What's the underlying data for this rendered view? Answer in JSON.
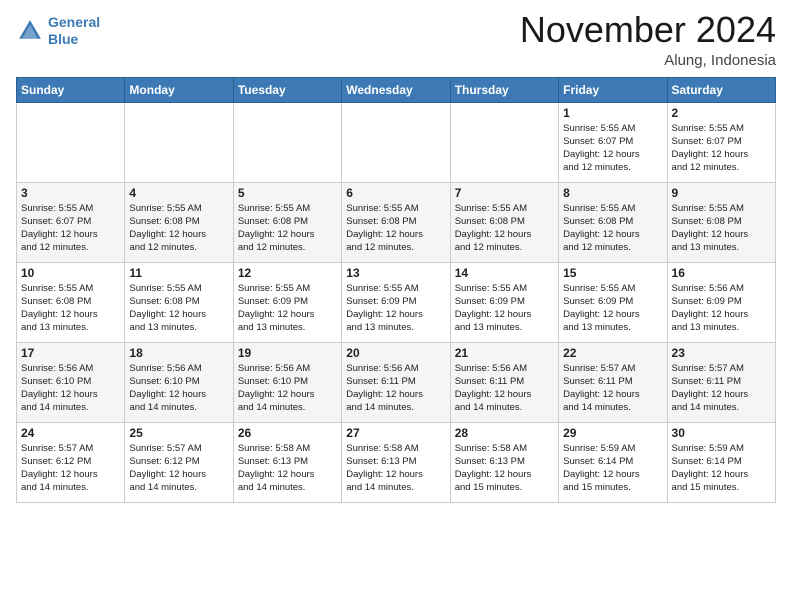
{
  "header": {
    "logo_line1": "General",
    "logo_line2": "Blue",
    "title": "November 2024",
    "subtitle": "Alung, Indonesia"
  },
  "days_of_week": [
    "Sunday",
    "Monday",
    "Tuesday",
    "Wednesday",
    "Thursday",
    "Friday",
    "Saturday"
  ],
  "weeks": [
    [
      {
        "day": "",
        "info": ""
      },
      {
        "day": "",
        "info": ""
      },
      {
        "day": "",
        "info": ""
      },
      {
        "day": "",
        "info": ""
      },
      {
        "day": "",
        "info": ""
      },
      {
        "day": "1",
        "info": "Sunrise: 5:55 AM\nSunset: 6:07 PM\nDaylight: 12 hours\nand 12 minutes."
      },
      {
        "day": "2",
        "info": "Sunrise: 5:55 AM\nSunset: 6:07 PM\nDaylight: 12 hours\nand 12 minutes."
      }
    ],
    [
      {
        "day": "3",
        "info": "Sunrise: 5:55 AM\nSunset: 6:07 PM\nDaylight: 12 hours\nand 12 minutes."
      },
      {
        "day": "4",
        "info": "Sunrise: 5:55 AM\nSunset: 6:08 PM\nDaylight: 12 hours\nand 12 minutes."
      },
      {
        "day": "5",
        "info": "Sunrise: 5:55 AM\nSunset: 6:08 PM\nDaylight: 12 hours\nand 12 minutes."
      },
      {
        "day": "6",
        "info": "Sunrise: 5:55 AM\nSunset: 6:08 PM\nDaylight: 12 hours\nand 12 minutes."
      },
      {
        "day": "7",
        "info": "Sunrise: 5:55 AM\nSunset: 6:08 PM\nDaylight: 12 hours\nand 12 minutes."
      },
      {
        "day": "8",
        "info": "Sunrise: 5:55 AM\nSunset: 6:08 PM\nDaylight: 12 hours\nand 12 minutes."
      },
      {
        "day": "9",
        "info": "Sunrise: 5:55 AM\nSunset: 6:08 PM\nDaylight: 12 hours\nand 13 minutes."
      }
    ],
    [
      {
        "day": "10",
        "info": "Sunrise: 5:55 AM\nSunset: 6:08 PM\nDaylight: 12 hours\nand 13 minutes."
      },
      {
        "day": "11",
        "info": "Sunrise: 5:55 AM\nSunset: 6:08 PM\nDaylight: 12 hours\nand 13 minutes."
      },
      {
        "day": "12",
        "info": "Sunrise: 5:55 AM\nSunset: 6:09 PM\nDaylight: 12 hours\nand 13 minutes."
      },
      {
        "day": "13",
        "info": "Sunrise: 5:55 AM\nSunset: 6:09 PM\nDaylight: 12 hours\nand 13 minutes."
      },
      {
        "day": "14",
        "info": "Sunrise: 5:55 AM\nSunset: 6:09 PM\nDaylight: 12 hours\nand 13 minutes."
      },
      {
        "day": "15",
        "info": "Sunrise: 5:55 AM\nSunset: 6:09 PM\nDaylight: 12 hours\nand 13 minutes."
      },
      {
        "day": "16",
        "info": "Sunrise: 5:56 AM\nSunset: 6:09 PM\nDaylight: 12 hours\nand 13 minutes."
      }
    ],
    [
      {
        "day": "17",
        "info": "Sunrise: 5:56 AM\nSunset: 6:10 PM\nDaylight: 12 hours\nand 14 minutes."
      },
      {
        "day": "18",
        "info": "Sunrise: 5:56 AM\nSunset: 6:10 PM\nDaylight: 12 hours\nand 14 minutes."
      },
      {
        "day": "19",
        "info": "Sunrise: 5:56 AM\nSunset: 6:10 PM\nDaylight: 12 hours\nand 14 minutes."
      },
      {
        "day": "20",
        "info": "Sunrise: 5:56 AM\nSunset: 6:11 PM\nDaylight: 12 hours\nand 14 minutes."
      },
      {
        "day": "21",
        "info": "Sunrise: 5:56 AM\nSunset: 6:11 PM\nDaylight: 12 hours\nand 14 minutes."
      },
      {
        "day": "22",
        "info": "Sunrise: 5:57 AM\nSunset: 6:11 PM\nDaylight: 12 hours\nand 14 minutes."
      },
      {
        "day": "23",
        "info": "Sunrise: 5:57 AM\nSunset: 6:11 PM\nDaylight: 12 hours\nand 14 minutes."
      }
    ],
    [
      {
        "day": "24",
        "info": "Sunrise: 5:57 AM\nSunset: 6:12 PM\nDaylight: 12 hours\nand 14 minutes."
      },
      {
        "day": "25",
        "info": "Sunrise: 5:57 AM\nSunset: 6:12 PM\nDaylight: 12 hours\nand 14 minutes."
      },
      {
        "day": "26",
        "info": "Sunrise: 5:58 AM\nSunset: 6:13 PM\nDaylight: 12 hours\nand 14 minutes."
      },
      {
        "day": "27",
        "info": "Sunrise: 5:58 AM\nSunset: 6:13 PM\nDaylight: 12 hours\nand 14 minutes."
      },
      {
        "day": "28",
        "info": "Sunrise: 5:58 AM\nSunset: 6:13 PM\nDaylight: 12 hours\nand 15 minutes."
      },
      {
        "day": "29",
        "info": "Sunrise: 5:59 AM\nSunset: 6:14 PM\nDaylight: 12 hours\nand 15 minutes."
      },
      {
        "day": "30",
        "info": "Sunrise: 5:59 AM\nSunset: 6:14 PM\nDaylight: 12 hours\nand 15 minutes."
      }
    ]
  ]
}
